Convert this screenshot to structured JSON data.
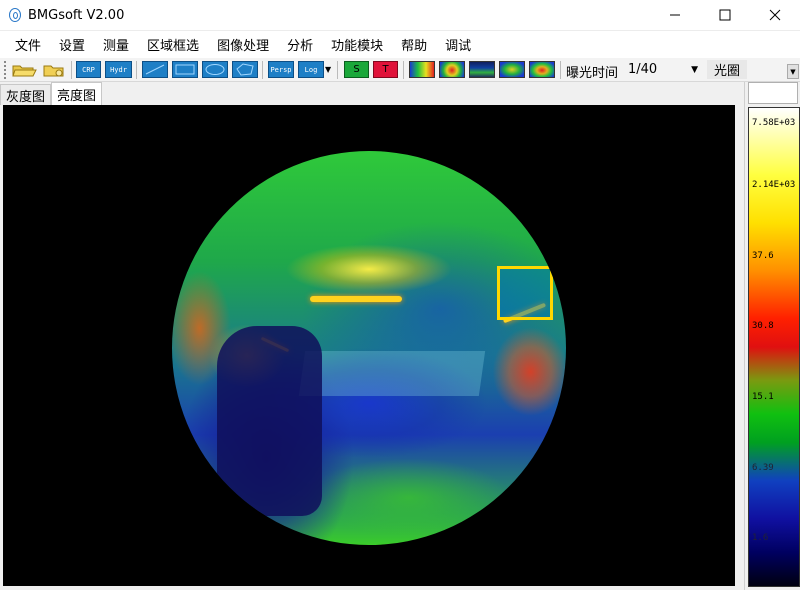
{
  "window": {
    "title": "BMGsoft V2.00",
    "minimize_icon": "minimize-icon",
    "maximize_icon": "maximize-icon",
    "close_icon": "close-icon"
  },
  "menu": [
    "文件",
    "设置",
    "测量",
    "区域框选",
    "图像处理",
    "分析",
    "功能模块",
    "帮助",
    "调试"
  ],
  "toolbar": {
    "crp_label": "CRP",
    "hydr_label": "Hydr",
    "persp_label": "Persp",
    "log_label": "Log",
    "s_label": "S",
    "t_label": "T",
    "exposure_label": "曝光时间",
    "exposure_value": "1/40",
    "aperture_label": "光圈"
  },
  "tabs": [
    "灰度图",
    "亮度图"
  ],
  "active_tab": "亮度图",
  "colorbar": {
    "ticks": [
      "7.58E+03",
      "2.14E+03",
      "37.6",
      "30.8",
      "15.1",
      "6.39",
      "1.6"
    ]
  },
  "colors": {
    "toolbar_blue": "#1e7fc6",
    "s_button": "#1aa83a",
    "t_button": "#e0123a"
  }
}
